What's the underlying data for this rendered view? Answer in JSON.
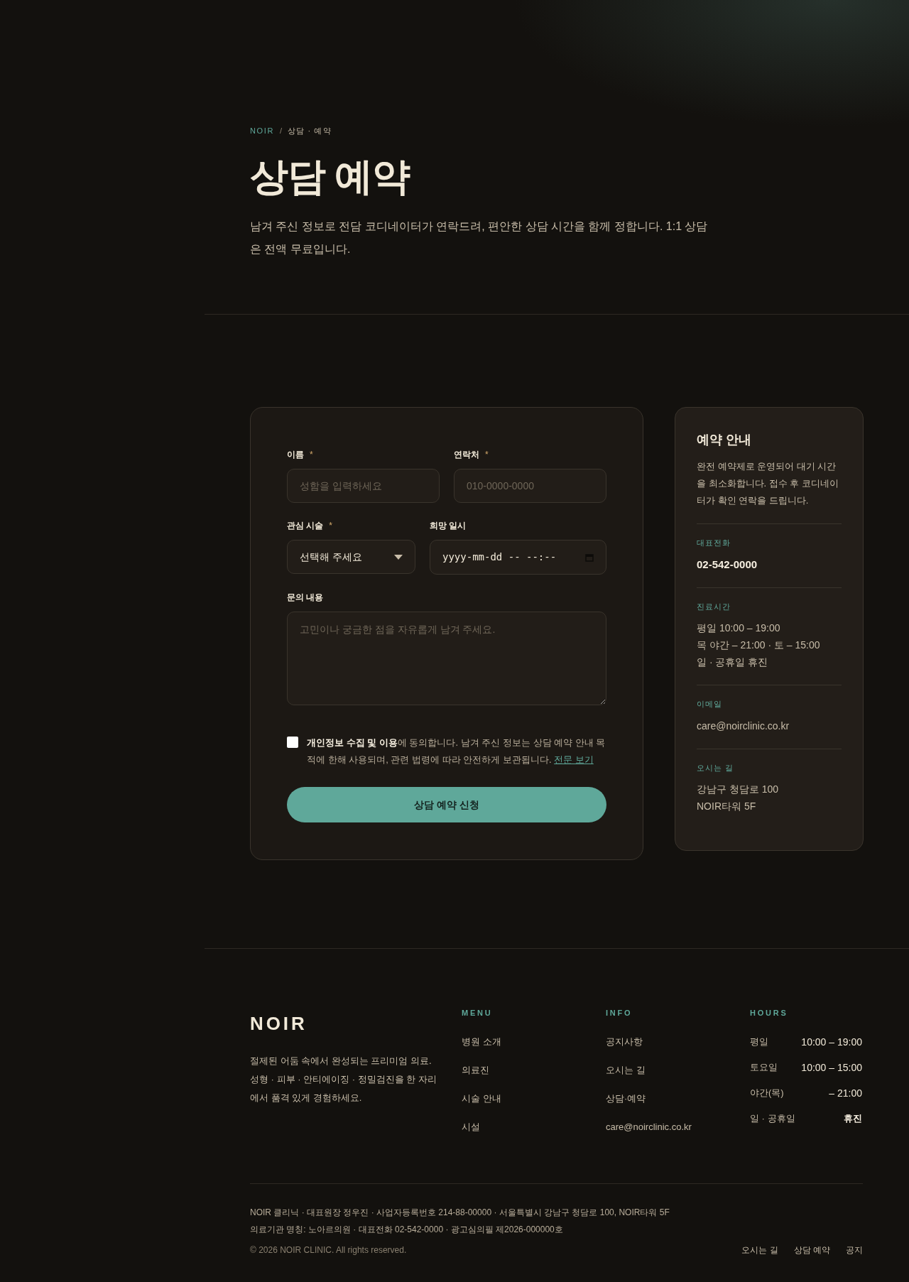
{
  "breadcrumb": {
    "home": "NOIR",
    "separator": "/",
    "current": "상담 · 예약"
  },
  "title": "상담 예약",
  "intro": "남겨 주신 정보로 전담 코디네이터가 연락드려, 편안한 상담 시간을 함께 정합니다. 1:1 상담은 전액 무료입니다.",
  "form": {
    "rows": [
      [
        {
          "kind": "text",
          "label": "이름",
          "required": true,
          "placeholder": "성함을 입력하세요"
        },
        {
          "kind": "text",
          "label": "연락처",
          "required": true,
          "placeholder": "010-0000-0000"
        }
      ],
      [
        {
          "kind": "select",
          "label": "관심 시술",
          "required": true,
          "value": "선택해 주세요"
        },
        {
          "kind": "datetime",
          "label": "희망 일시",
          "required": false,
          "value": "yyyy-mm-dd -- --:--"
        }
      ],
      [
        {
          "kind": "textarea",
          "label": "문의 내용",
          "required": false,
          "placeholder": "고민이나 궁금한 점을 자유롭게 남겨 주세요."
        }
      ]
    ],
    "required_mark": "*",
    "consent": {
      "checked": false,
      "text": "**개인정보 수집 및 이용**에 동의합니다. 남겨 주신 정보는 상담 예약 안내 목적에 한해 사용되며, 관련 법령에 따라 안전하게 보관됩니다.",
      "link": "전문 보기"
    },
    "submit": "상담 예약 신청"
  },
  "info": {
    "title": "예약 안내",
    "text": "완전 예약제로 운영되어 대기 시간을 최소화합니다. 접수 후 코디네이터가 확인 연락을 드립니다.",
    "sections": [
      {
        "kind": "phone",
        "label": "대표전화",
        "lines": [
          "02-542-0000"
        ]
      },
      {
        "kind": "plain",
        "label": "진료시간",
        "lines": [
          "평일 10:00 – 19:00",
          "목 야간 – 21:00 · 토 – 15:00",
          "일 · 공휴일 휴진"
        ]
      },
      {
        "kind": "plain",
        "label": "이메일",
        "lines": [
          "care@noirclinic.co.kr"
        ]
      },
      {
        "kind": "plain",
        "label": "오시는 길",
        "lines": [
          "강남구 청담로 100",
          "NOIR타워 5F"
        ]
      }
    ]
  },
  "footer": {
    "logo": "NOIR",
    "tagline": "절제된 어둠 속에서 완성되는 프리미엄 의료. 성형 · 피부 · 안티에이징 · 정밀검진을 한 자리에서 품격 있게 경험하세요.",
    "menu": {
      "title": "MENU",
      "items": [
        "병원 소개",
        "의료진",
        "시술 안내",
        "시설"
      ]
    },
    "info": {
      "title": "INFO",
      "items": [
        "공지사항",
        "오시는 길",
        "상담·예약",
        "care@noirclinic.co.kr"
      ]
    },
    "hours": {
      "title": "HOURS",
      "rows": [
        {
          "day": "평일",
          "time": "10:00 – 19:00",
          "closed": false
        },
        {
          "day": "토요일",
          "time": "10:00 – 15:00",
          "closed": false
        },
        {
          "day": "야간(목)",
          "time": "– 21:00",
          "closed": false
        },
        {
          "day": "일 · 공휴일",
          "time": "휴진",
          "closed": true
        }
      ]
    },
    "legal": [
      "NOIR 클리닉 · 대표원장 정우진 · 사업자등록번호 214-88-00000 · 서울특별시 강남구 청담로 100, NOIR타워 5F",
      "의료기관 명칭: 노아르의원 · 대표전화 02-542-0000 · 광고심의필 제2026-000000호"
    ],
    "copyright": "© 2026 NOIR CLINIC. All rights reserved.",
    "links": [
      "오시는 길",
      "상담 예약",
      "공지"
    ]
  }
}
